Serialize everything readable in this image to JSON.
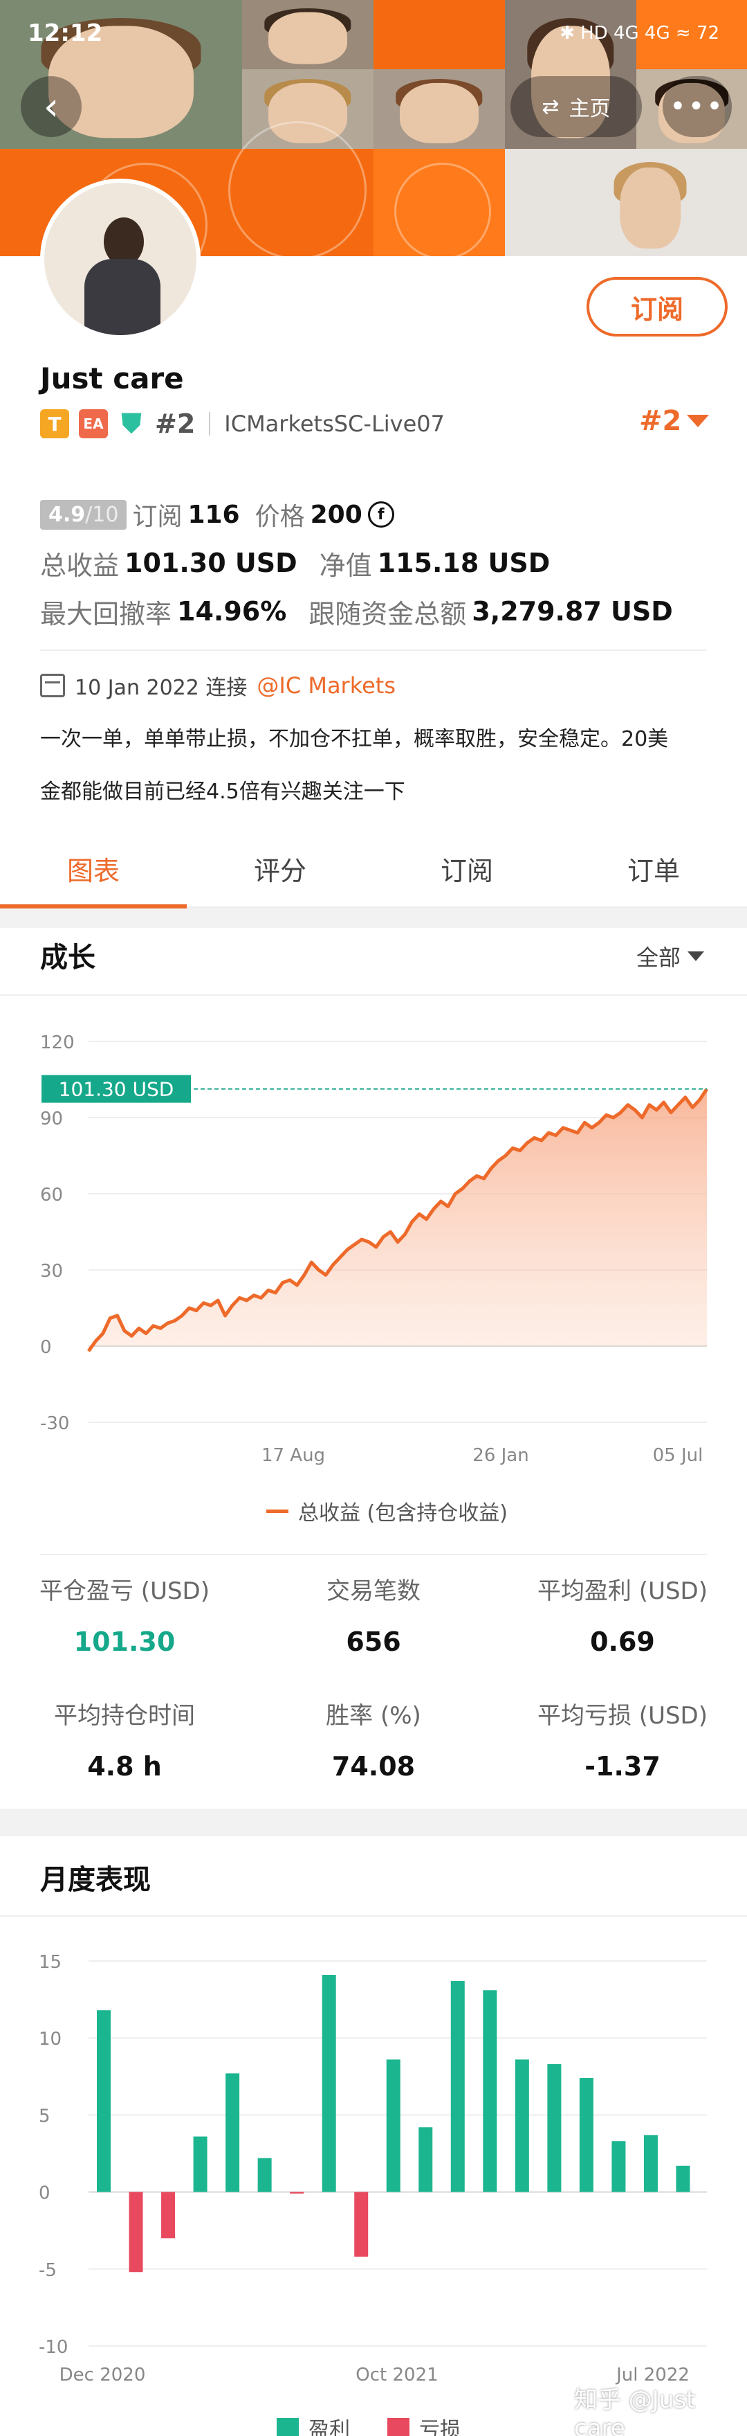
{
  "status_bar": {
    "time": "12:12",
    "icons": "✱ HD 4G 4G ≈ 72"
  },
  "nav": {
    "home_label": "主页",
    "more_label": "•••",
    "back_label": "‹"
  },
  "profile": {
    "name": "Just care",
    "badge_t": "T",
    "badge_ea": "EA",
    "rank": "#2",
    "account": "ICMarketsSC-Live07",
    "rank_right": "#2",
    "subscribe_label": "订阅"
  },
  "stats": {
    "score": "4.9",
    "score_max": "/10",
    "subscribers_label": "订阅",
    "subscribers": "116",
    "price_label": "价格",
    "price": "200",
    "coin_symbol": "f",
    "total_profit_label": "总收益",
    "total_profit": "101.30 USD",
    "net_value_label": "净值",
    "net_value": "115.18 USD",
    "max_drawdown_label": "最大回撤率",
    "max_drawdown": "14.96%",
    "follow_funds_label": "跟随资金总额",
    "follow_funds": "3,279.87 USD"
  },
  "connection": {
    "date_text": "10 Jan 2022 连接",
    "broker": "@IC Markets"
  },
  "description_line1": "一次一单，单单带止损，不加仓不扛单，概率取胜，安全稳定。20美",
  "description_line2": "金都能做目前已经4.5倍有兴趣关注一下",
  "tabs": [
    "图表",
    "评分",
    "订阅",
    "订单"
  ],
  "growth": {
    "title": "成长",
    "filter": "全部",
    "current_label": "101.30 USD",
    "legend": "总收益 (包含持仓收益)"
  },
  "metrics": {
    "closed_pl_label": "平仓盈亏 (USD)",
    "closed_pl": "101.30",
    "trades_label": "交易笔数",
    "trades": "656",
    "avg_profit_label": "平均盈利 (USD)",
    "avg_profit": "0.69",
    "avg_hold_label": "平均持仓时间",
    "avg_hold": "4.8 h",
    "win_rate_label": "胜率 (%)",
    "win_rate": "74.08",
    "avg_loss_label": "平均亏损 (USD)",
    "avg_loss": "-1.37"
  },
  "monthly": {
    "title": "月度表现",
    "legend_profit": "盈利",
    "legend_loss": "亏损"
  },
  "watermark": "知乎 @Just care",
  "colors": {
    "accent": "#ee6a2a",
    "profit": "#1bb58f",
    "loss": "#e8495f"
  },
  "chart_data": [
    {
      "type": "area",
      "title": "",
      "yticks": [
        120,
        90,
        60,
        30,
        0,
        -30
      ],
      "ylim": [
        -30,
        120
      ],
      "xticks": [
        "17 Aug",
        "26 Jan",
        "05 Jul"
      ],
      "current_value": 101.3,
      "series": [
        {
          "name": "总收益 (包含持仓收益)",
          "values": [
            -2,
            2,
            5,
            11,
            12,
            6,
            4,
            7,
            5,
            8,
            7,
            9,
            10,
            12,
            15,
            14,
            17,
            16,
            18,
            12,
            16,
            19,
            18,
            20,
            19,
            22,
            21,
            25,
            26,
            24,
            28,
            33,
            30,
            28,
            32,
            35,
            38,
            40,
            42,
            41,
            39,
            43,
            45,
            41,
            44,
            49,
            52,
            50,
            54,
            57,
            55,
            60,
            62,
            65,
            67,
            66,
            70,
            73,
            75,
            78,
            77,
            80,
            82,
            81,
            84,
            83,
            86,
            85,
            84,
            88,
            86,
            88,
            91,
            90,
            92,
            95,
            93,
            90,
            95,
            93,
            96,
            92,
            95,
            98,
            94,
            97,
            101.3
          ]
        }
      ]
    },
    {
      "type": "bar",
      "title": "",
      "ylim": [
        -10,
        15
      ],
      "yticks": [
        15,
        10,
        5,
        0,
        -5,
        -10
      ],
      "xticks": [
        "Dec 2020",
        "Oct 2021",
        "Jul 2022"
      ],
      "values": [
        11.8,
        -5.2,
        -3.0,
        3.6,
        7.7,
        2.2,
        -0.1,
        14.1,
        -4.2,
        8.6,
        4.2,
        13.7,
        13.1,
        8.6,
        8.3,
        7.4,
        3.3,
        3.7,
        1.7
      ],
      "legend": [
        "盈利",
        "亏损"
      ]
    }
  ]
}
